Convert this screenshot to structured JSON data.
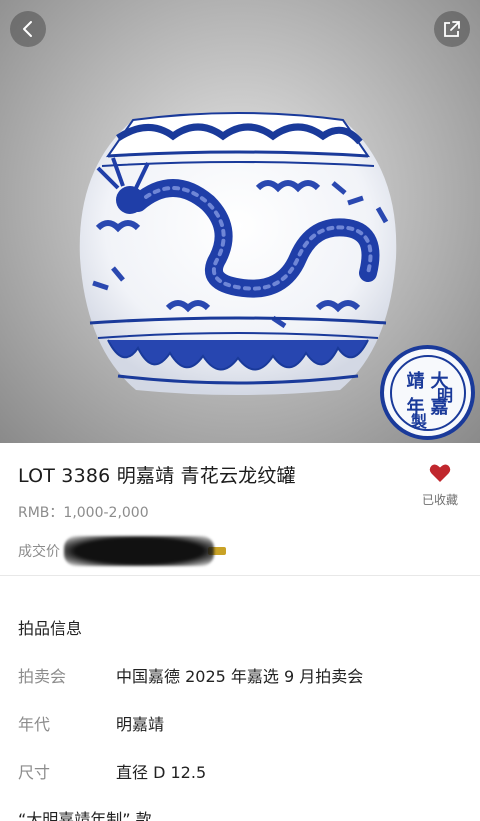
{
  "hero": {
    "seal_chars": [
      "大",
      "明",
      "嘉",
      "靖",
      "年",
      "製"
    ]
  },
  "lot": {
    "title": "LOT 3386 明嘉靖  青花云龙纹罐",
    "estimate": "RMB：1,000-2,000",
    "deal_label": "成交价",
    "favorite_label": "已收藏",
    "favorite_color": "#c0272d"
  },
  "info": {
    "heading": "拍品信息",
    "rows": [
      {
        "label": "拍卖会",
        "value": "中国嘉德 2025 年嘉选 9 月拍卖会"
      },
      {
        "label": "年代",
        "value": "明嘉靖"
      },
      {
        "label": "尺寸",
        "value": "直径  D 12.5"
      }
    ],
    "note": "“大明嘉靖年制” 款"
  },
  "colors": {
    "cobalt": "#1a3a9a",
    "muted_text": "#8c8c8c"
  }
}
